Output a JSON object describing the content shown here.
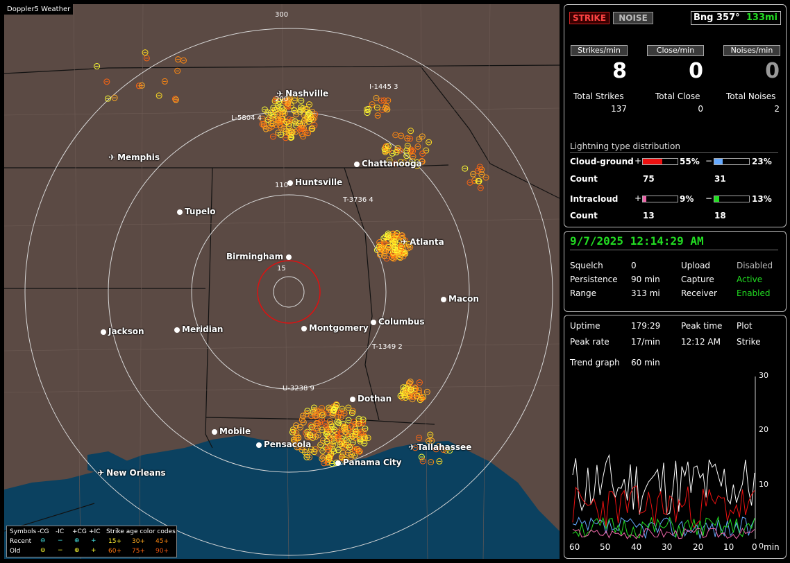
{
  "app": {
    "title": "Doppler5 Weather"
  },
  "map": {
    "range_labels": [
      "300",
      "200",
      "110",
      "15"
    ],
    "cities": [
      {
        "name": "Nashville",
        "kind": "airport"
      },
      {
        "name": "Memphis",
        "kind": "airport"
      },
      {
        "name": "Chattanooga",
        "kind": "city"
      },
      {
        "name": "Huntsville",
        "kind": "city"
      },
      {
        "name": "Tupelo",
        "kind": "city"
      },
      {
        "name": "Birmingham",
        "kind": "city"
      },
      {
        "name": "Atlanta",
        "kind": "airport"
      },
      {
        "name": "Macon",
        "kind": "city"
      },
      {
        "name": "Jackson",
        "kind": "city"
      },
      {
        "name": "Meridian",
        "kind": "city"
      },
      {
        "name": "Montgomery",
        "kind": "city"
      },
      {
        "name": "Columbus",
        "kind": "city"
      },
      {
        "name": "Dothan",
        "kind": "city"
      },
      {
        "name": "Mobile",
        "kind": "city"
      },
      {
        "name": "Pensacola",
        "kind": "city"
      },
      {
        "name": "Tallahassee",
        "kind": "airport"
      },
      {
        "name": "Panama City",
        "kind": "city"
      },
      {
        "name": "New Orleans",
        "kind": "airport"
      }
    ],
    "storm_tags": [
      "I-1445 3",
      "L-5804 4",
      "T-3736 4",
      "T-1349 2",
      "U-3238 9"
    ]
  },
  "legend": {
    "symbols_label": "Symbols",
    "cols": [
      "-CG",
      "-IC",
      "+CG",
      "+IC"
    ],
    "rows": [
      "Recent",
      "Old"
    ],
    "age_title": "Strike age color codes",
    "recent_ages": [
      "15+",
      "30+",
      "45+"
    ],
    "old_ages": [
      "60+",
      "75+",
      "90+"
    ],
    "recent_symbols": [
      "⊖",
      "−",
      "⊕",
      "+"
    ],
    "old_symbols": [
      "⊖",
      "−",
      "⊕",
      "+"
    ]
  },
  "status": {
    "strike_btn": "STRIKE",
    "noise_btn": "NOISE",
    "bearing_label": "Bng 357°",
    "bearing_distance": "133mi",
    "rate_headers": [
      "Strikes/min",
      "Close/min",
      "Noises/min"
    ],
    "rates": [
      "8",
      "0",
      "0"
    ],
    "totals_labels": [
      "Total Strikes",
      "Total Close",
      "Total Noises"
    ],
    "totals": [
      "137",
      "0",
      "2"
    ],
    "dist_title": "Lightning type distribution",
    "cg_label": "Cloud-ground",
    "ic_label": "Intracloud",
    "count_label": "Count",
    "plus_sign": "+",
    "minus_sign": "−",
    "cg_pos_pct": "55%",
    "cg_neg_pct": "23%",
    "ic_pos_pct": "9%",
    "ic_neg_pct": "13%",
    "cg_pos_count": "75",
    "cg_neg_count": "31",
    "ic_pos_count": "13",
    "ic_neg_count": "18",
    "cg_pos_level": 0.55,
    "cg_neg_level": 0.23,
    "ic_pos_level": 0.09,
    "ic_neg_level": 0.13,
    "colors": {
      "cg_pos": "#ee1111",
      "cg_neg": "#66aaff",
      "ic_pos": "#ee66aa",
      "ic_neg": "#22dd22",
      "active": "#22dd22"
    }
  },
  "settings": {
    "datetime": "9/7/2025 12:14:29 AM",
    "squelch_label": "Squelch",
    "squelch": "0",
    "persistence_label": "Persistence",
    "persistence": "90 min",
    "range_label": "Range",
    "range": "313 mi",
    "upload_label": "Upload",
    "upload": "Disabled",
    "capture_label": "Capture",
    "capture": "Active",
    "receiver_label": "Receiver",
    "receiver": "Enabled"
  },
  "trend": {
    "uptime_label": "Uptime",
    "uptime": "179:29",
    "peak_time_label": "Peak time",
    "peak_time": "12:12 AM",
    "plot_label": "Plot",
    "plot": "Strike",
    "peak_rate_label": "Peak rate",
    "peak_rate": "17/min",
    "graph_label": "Trend graph",
    "graph_span": "60 min",
    "y_ticks": [
      "30",
      "20",
      "10",
      "0"
    ],
    "x_ticks": [
      "60",
      "50",
      "40",
      "30",
      "20",
      "10",
      "0"
    ],
    "x_unit": "min"
  }
}
